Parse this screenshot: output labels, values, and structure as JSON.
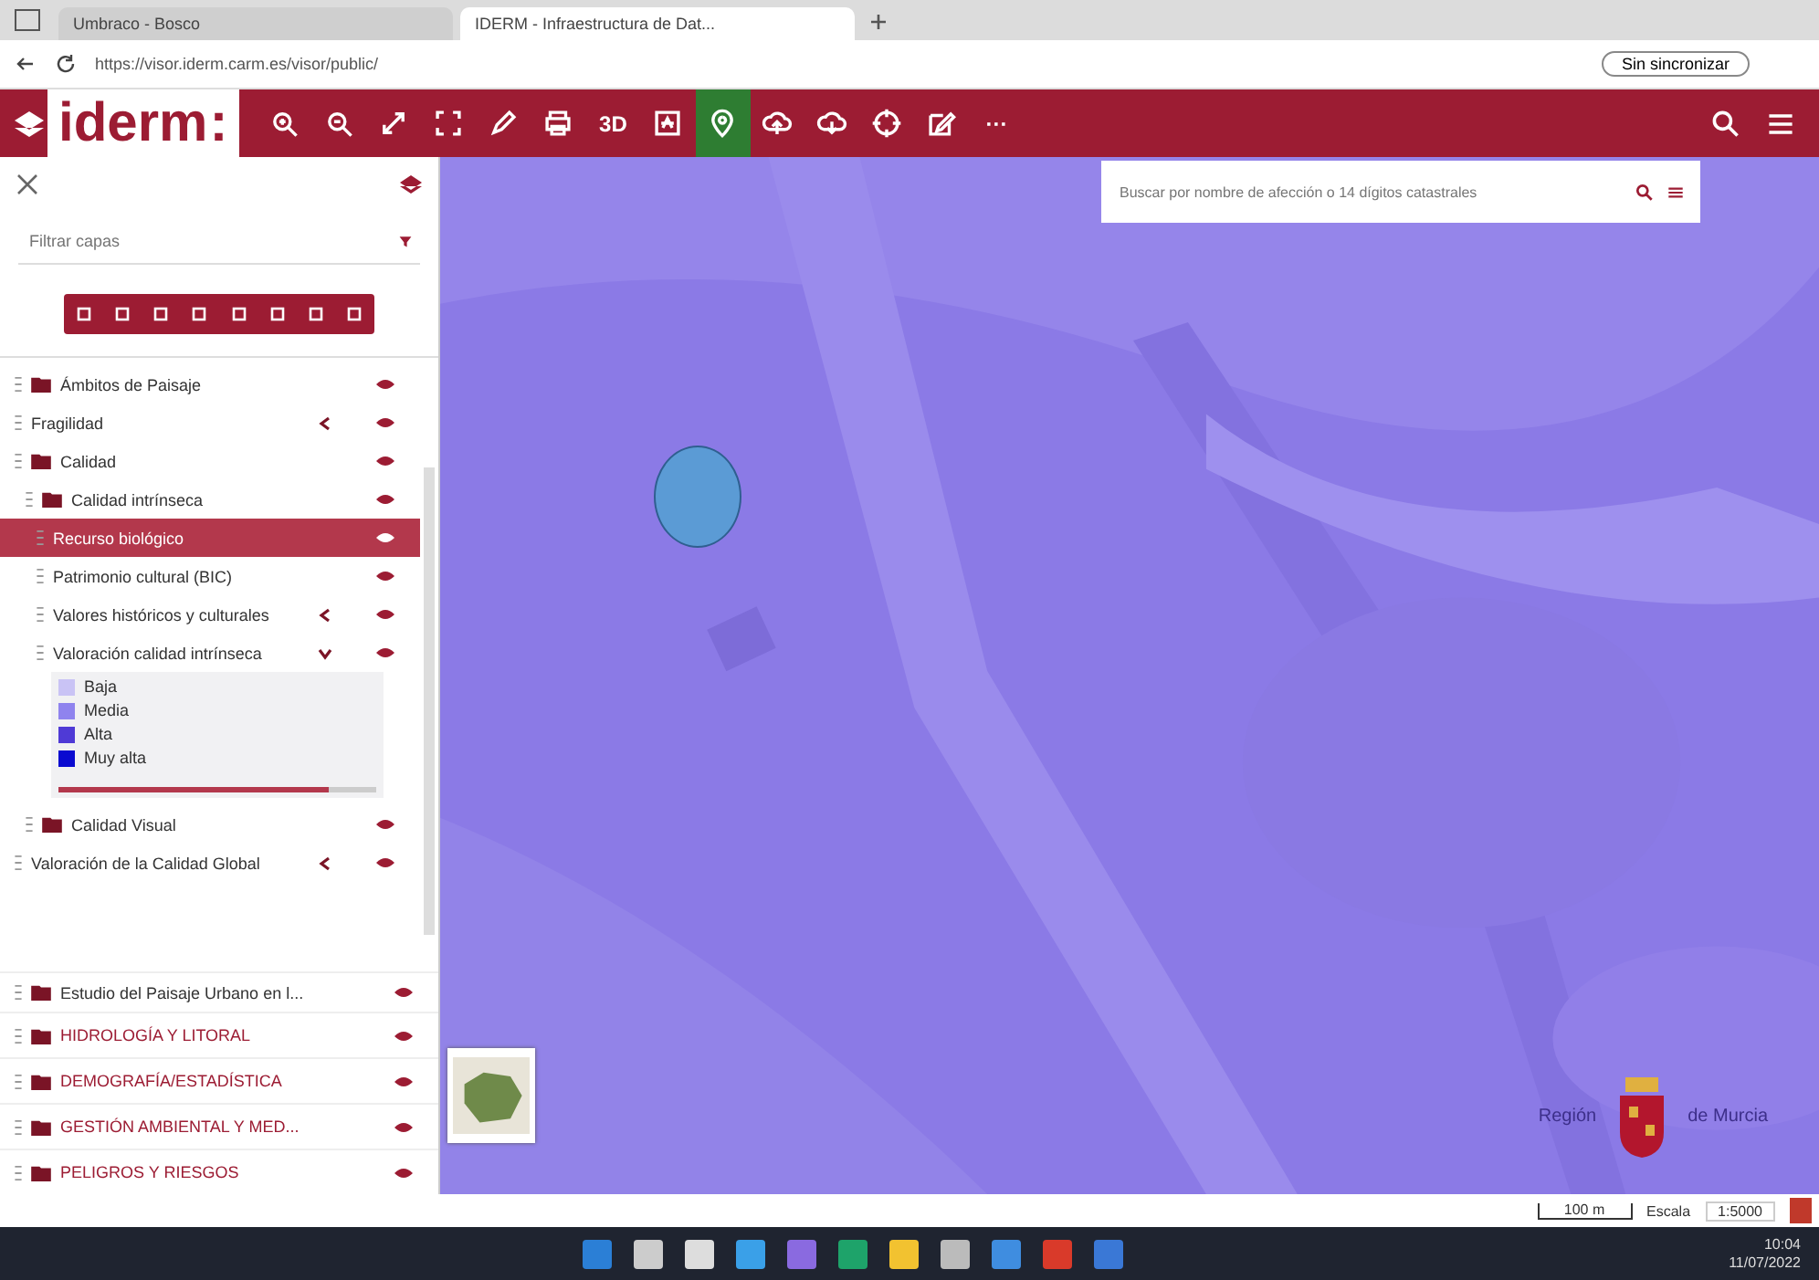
{
  "browser": {
    "tabs": [
      {
        "title": "Umbraco - Bosco",
        "selected": false
      },
      {
        "title": "IDERM - Infraestructura de Dat...",
        "selected": true
      }
    ],
    "url": "https://visor.iderm.carm.es/visor/public/",
    "sync_button": "Sin sincronizar"
  },
  "app": {
    "logo_text": "iderm",
    "logo_colon": ":",
    "tools": [
      {
        "selected": false
      },
      {
        "selected": false
      },
      {
        "selected": false
      },
      {
        "selected": false
      },
      {
        "selected": false
      },
      {
        "selected": false
      },
      {
        "label": "3D",
        "selected": false
      },
      {
        "selected": false
      },
      {
        "selected": true
      },
      {
        "selected": false
      },
      {
        "selected": false
      },
      {
        "selected": false
      },
      {
        "selected": false
      },
      {
        "label": "···",
        "selected": false
      }
    ]
  },
  "layers_panel": {
    "filter": {
      "placeholder": "Filtrar capas"
    },
    "tree": [
      {
        "kind": "folder",
        "label": "Ámbitos de Paisaje",
        "selected": false
      },
      {
        "kind": "chevron_layer",
        "label": "Fragilidad",
        "expanded": false,
        "selected": false
      },
      {
        "kind": "folder",
        "label": "Calidad",
        "selected": false,
        "children": [
          {
            "kind": "folder",
            "label": "Calidad intrínseca",
            "selected": false,
            "children": [
              {
                "kind": "layer",
                "label": "Recurso biológico",
                "selected": true
              },
              {
                "kind": "layer",
                "label": "Patrimonio cultural (BIC)",
                "selected": false
              },
              {
                "kind": "chevron_layer",
                "label": "Valores históricos y culturales",
                "expanded": false,
                "selected": false
              },
              {
                "kind": "chevron_layer",
                "label": "Valoración calidad intrínseca",
                "expanded": true,
                "selected": false,
                "level": 0.85,
                "legend": [
                  {
                    "label": "Baja",
                    "color": "#c9c3f5"
                  },
                  {
                    "label": "Media",
                    "color": "#8f83ee"
                  },
                  {
                    "label": "Alta",
                    "color": "#4f3ad6"
                  },
                  {
                    "label": "Muy alta",
                    "color": "#0a0ad0"
                  }
                ]
              }
            ]
          },
          {
            "kind": "folder",
            "label": "Calidad Visual",
            "selected": false
          }
        ]
      },
      {
        "kind": "chevron_layer",
        "label": "Valoración de la Calidad Global",
        "expanded": false,
        "selected": false
      }
    ],
    "subgroup": "Estudio del Paisaje Urbano en l...",
    "sections": [
      "HIDROLOGÍA Y LITORAL",
      "DEMOGRAFÍA/ESTADÍSTICA",
      "GESTIÓN AMBIENTAL Y MED...",
      "PELIGROS Y RIESGOS"
    ]
  },
  "map": {
    "search": {
      "placeholder": "Buscar por nombre de afección o 14 dígitos catastrales"
    },
    "region_logo": [
      "Región",
      "de Murcia"
    ]
  },
  "status_bar": {
    "scale_bar": "100 m",
    "scale_label": "Escala",
    "scale_value": "1:5000"
  },
  "taskbar": {
    "time": "10:04",
    "date": "11/07/2022"
  }
}
